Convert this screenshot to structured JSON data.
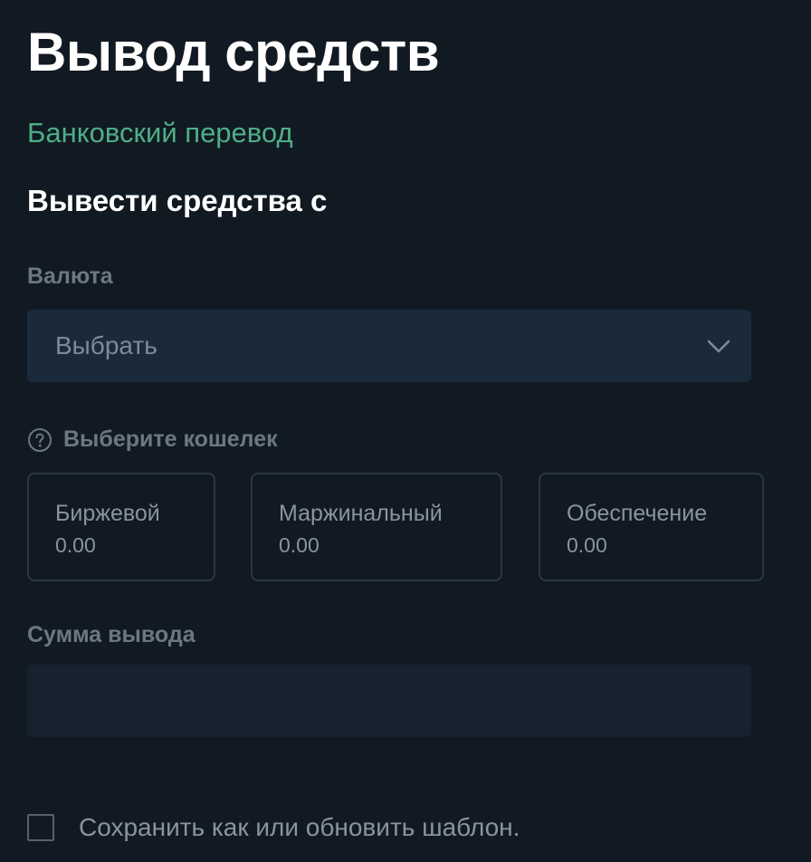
{
  "header": {
    "title": "Вывод средств"
  },
  "withdrawal_method": {
    "label": "Банковский перевод"
  },
  "source_section": {
    "heading": "Вывести средства с"
  },
  "currency": {
    "label": "Валюта",
    "selected_value": "Выбрать",
    "icon": "chevron-down-icon"
  },
  "wallet": {
    "label": "Выберите кошелек",
    "help_icon": "question-circle-icon",
    "options": [
      {
        "name": "Биржевой",
        "balance": "0.00"
      },
      {
        "name": "Маржинальный",
        "balance": "0.00"
      },
      {
        "name": "Обеспечение",
        "balance": "0.00"
      }
    ]
  },
  "amount": {
    "label": "Сумма вывода",
    "value": "",
    "placeholder": ""
  },
  "template_checkbox": {
    "label": "Сохранить как или обновить шаблон.",
    "checked": false
  },
  "colors": {
    "background": "#111a23",
    "accent_green": "#4fae86",
    "select_background": "#1b2a3b",
    "input_background": "#16222d",
    "card_border": "#2b3640",
    "muted_text": "#6b7883"
  }
}
